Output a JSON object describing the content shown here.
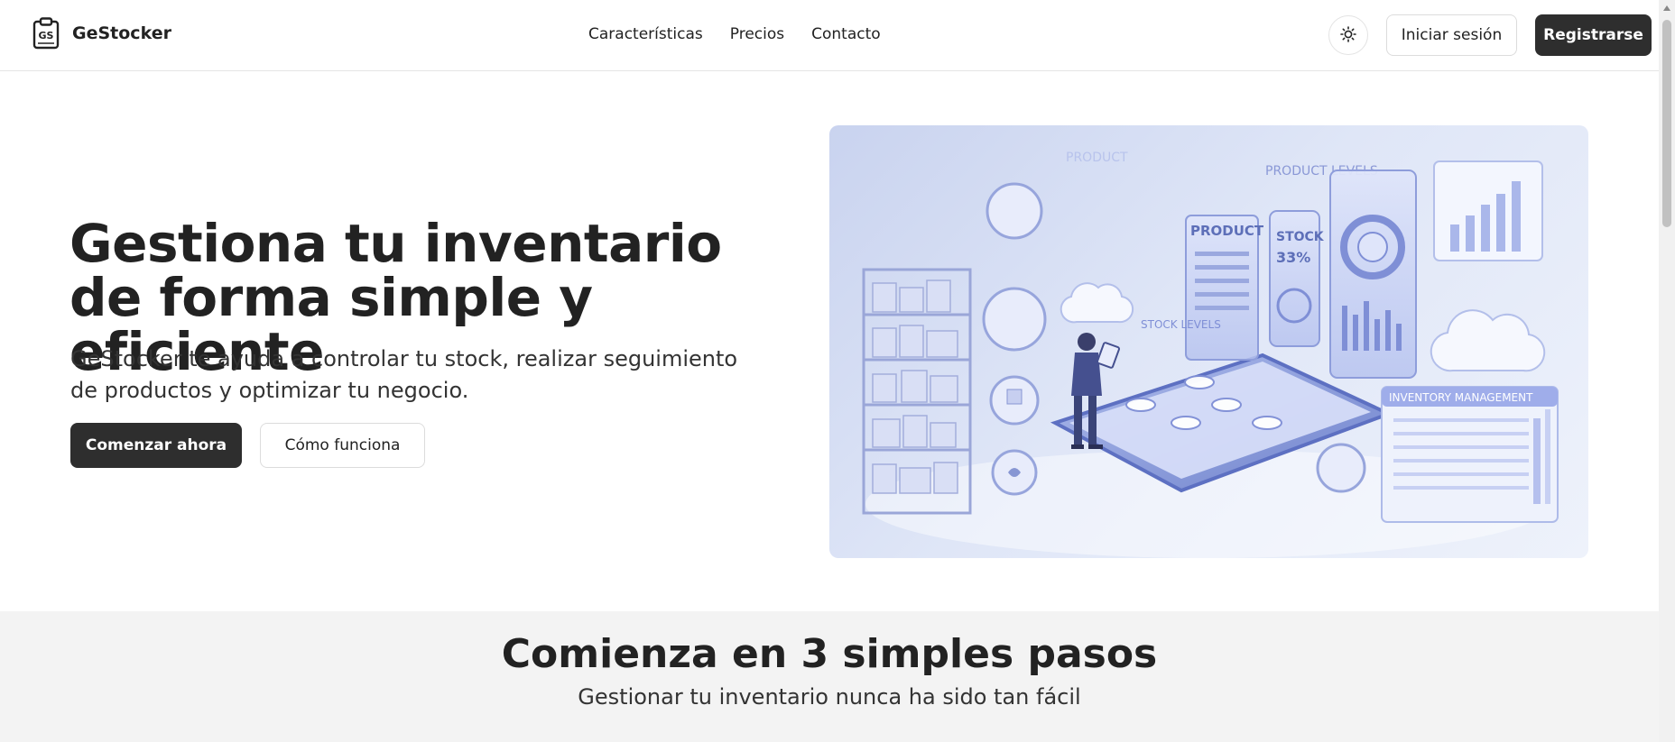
{
  "brand": {
    "name": "GeStocker",
    "logo_text": "GS"
  },
  "nav": {
    "items": [
      {
        "label": "Características"
      },
      {
        "label": "Precios"
      },
      {
        "label": "Contacto"
      }
    ]
  },
  "header_actions": {
    "theme_icon": "sun-icon",
    "login_label": "Iniciar sesión",
    "register_label": "Registrarse"
  },
  "hero": {
    "title": "Gestiona tu inventario de forma simple y eficiente",
    "subtitle": "GeStocker te ayuda a controlar tu stock, realizar seguimiento de productos y optimizar tu negocio.",
    "primary_cta": "Comenzar ahora",
    "secondary_cta": "Cómo funciona",
    "image_labels": {
      "product": "PRODUCT",
      "product_levels": "PRODUCT LEVELS",
      "stock": "STOCK",
      "stock_pct": "33%",
      "stock_levels": "STOCK LEVELS",
      "inventory_management": "INVENTORY MANAGEMENT"
    }
  },
  "steps": {
    "title": "Comienza en 3 simples pasos",
    "subtitle": "Gestionar tu inventario nunca ha sido tan fácil"
  },
  "colors": {
    "primary_dark": "#2e2e2e",
    "section_bg": "#f3f3f3",
    "illustration_blue": "#7f8fd6"
  }
}
